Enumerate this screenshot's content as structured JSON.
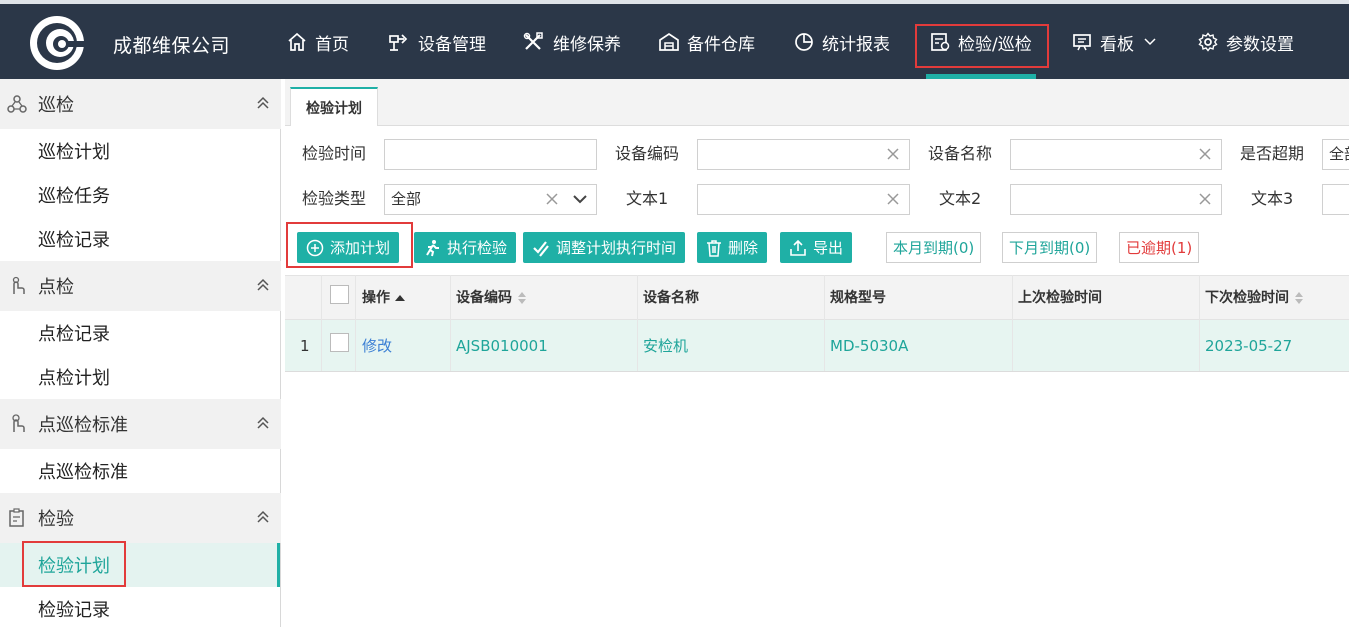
{
  "brand": {
    "name": "成都维保公司"
  },
  "nav": [
    {
      "label": "首页",
      "icon": "home-icon"
    },
    {
      "label": "设备管理",
      "icon": "equipment-icon"
    },
    {
      "label": "维修保养",
      "icon": "tools-icon"
    },
    {
      "label": "备件仓库",
      "icon": "warehouse-icon"
    },
    {
      "label": "统计报表",
      "icon": "pie-chart-icon"
    },
    {
      "label": "检验/巡检",
      "icon": "inspection-icon",
      "active": true
    },
    {
      "label": "看板",
      "icon": "board-icon"
    },
    {
      "label": "参数设置",
      "icon": "gear-icon"
    }
  ],
  "sidebar": {
    "groups": [
      {
        "title": "巡检",
        "icon": "patrol-icon",
        "items": [
          "巡检计划",
          "巡检任务",
          "巡检记录"
        ]
      },
      {
        "title": "点检",
        "icon": "spot-check-icon",
        "items": [
          "点检记录",
          "点检计划"
        ]
      },
      {
        "title": "点巡检标准",
        "icon": "standard-icon",
        "items": [
          "点巡检标准"
        ]
      },
      {
        "title": "检验",
        "icon": "clipboard-icon",
        "items": [
          "检验计划",
          "检验记录"
        ],
        "active_item": "检验计划"
      }
    ]
  },
  "tab": {
    "label": "检验计划"
  },
  "filters": {
    "inspect_time": {
      "label": "检验时间",
      "value": ""
    },
    "device_code": {
      "label": "设备编码",
      "value": ""
    },
    "device_name": {
      "label": "设备名称",
      "value": ""
    },
    "overdue": {
      "label": "是否超期",
      "value": "全部"
    },
    "inspect_type": {
      "label": "检验类型",
      "value": "全部"
    },
    "text1": {
      "label": "文本1",
      "value": ""
    },
    "text2": {
      "label": "文本2",
      "value": ""
    },
    "text3": {
      "label": "文本3",
      "value": ""
    }
  },
  "toolbar": {
    "add": "添加计划",
    "execute": "执行检验",
    "adjust": "调整计划执行时间",
    "delete": "删除",
    "export": "导出",
    "this_month": "本月到期(0)",
    "next_month": "下月到期(0)",
    "overdue": "已逾期(1)"
  },
  "table": {
    "columns": [
      "操作",
      "设备编码",
      "设备名称",
      "规格型号",
      "上次检验时间",
      "下次检验时间"
    ],
    "rows": [
      {
        "index": "1",
        "action": "修改",
        "code": "AJSB010001",
        "name": "安检机",
        "model": "MD-5030A",
        "last": "",
        "next": "2023-05-27"
      }
    ]
  },
  "colors": {
    "accent": "#1fb0a6",
    "nav_bg": "#2b3748",
    "highlight": "#e23b3b",
    "overdue": "#e23b3b"
  }
}
